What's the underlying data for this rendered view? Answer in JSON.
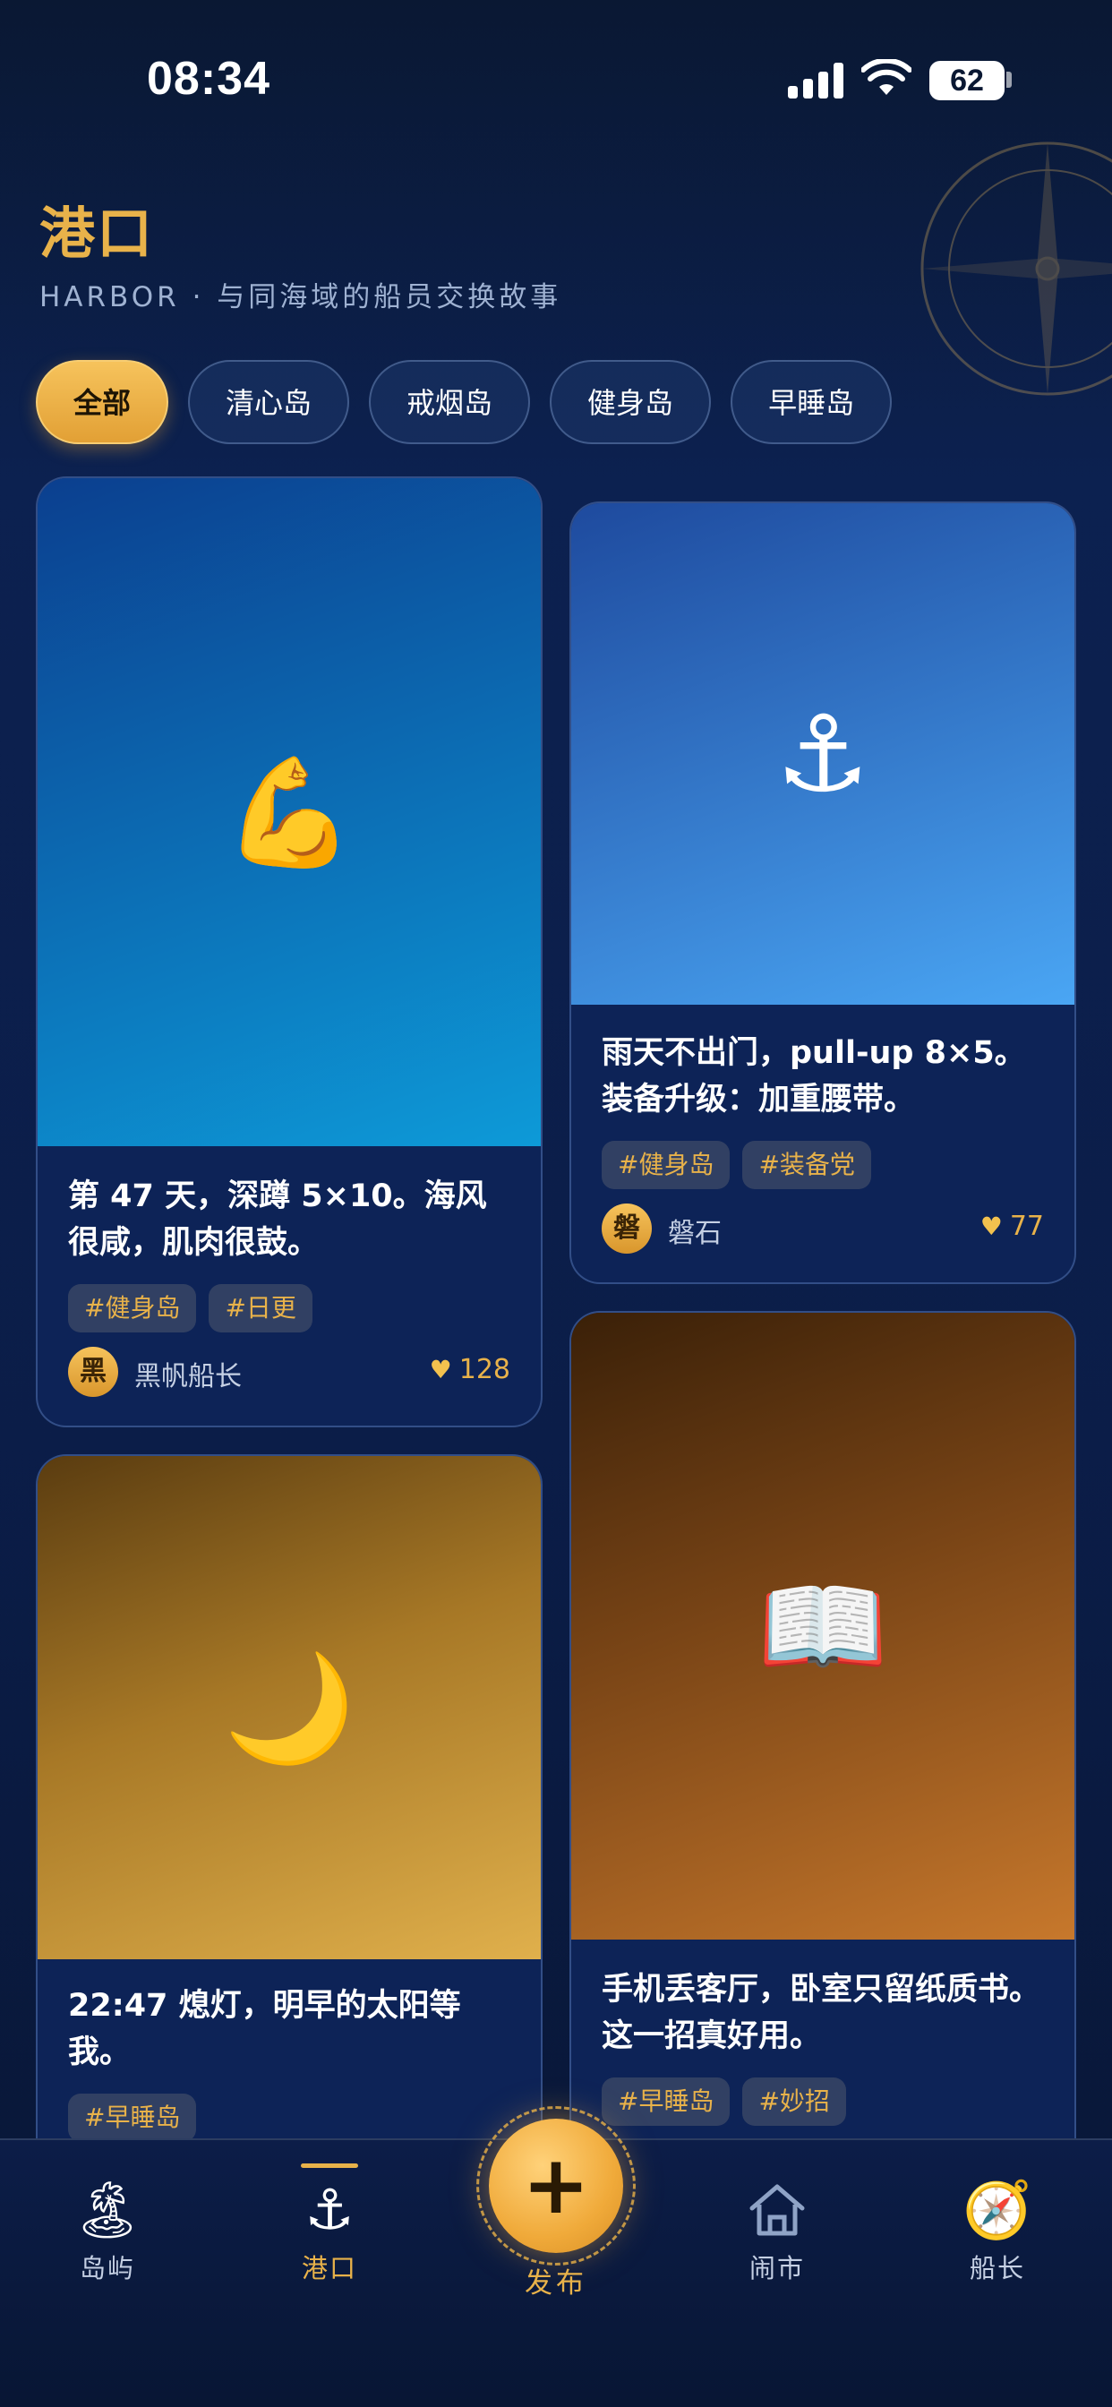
{
  "status_bar": {
    "time": "08:34",
    "battery": "62"
  },
  "header": {
    "title": "港口",
    "subtitle": "HARBOR · 与同海域的船员交换故事"
  },
  "filters": [
    {
      "label": "全部",
      "active": true
    },
    {
      "label": "清心岛",
      "active": false
    },
    {
      "label": "戒烟岛",
      "active": false
    },
    {
      "label": "健身岛",
      "active": false
    },
    {
      "label": "早睡岛",
      "active": false
    }
  ],
  "posts": [
    {
      "icon": "flexed-biceps-icon",
      "emoji": "💪",
      "text": "第 47 天，深蹲 5×10。海风很咸，肌肉很鼓。",
      "tags": [
        "#健身岛",
        "#日更"
      ],
      "avatar": "黑",
      "author": "黑帆船长",
      "likes": "128",
      "colors": [
        "#0b3f8f",
        "#0d9ad8"
      ]
    },
    {
      "icon": "anchor-icon",
      "emoji": "⚓",
      "text": "雨天不出门，pull-up 8×5。装备升级：加重腰带。",
      "tags": [
        "#健身岛",
        "#装备党"
      ],
      "avatar": "磐",
      "author": "磐石",
      "likes": "77",
      "colors": [
        "#1e4a9e",
        "#4aa6f4"
      ]
    },
    {
      "icon": "crescent-moon-icon",
      "emoji": "🌙",
      "text": "22:47 熄灯，明早的太阳等我。",
      "tags": [
        "#早睡岛"
      ],
      "colors": [
        "#5a3c10",
        "#e0b04c"
      ]
    },
    {
      "icon": "open-book-icon",
      "emoji": "📖",
      "text": "手机丢客厅，卧室只留纸质书。这一招真好用。",
      "tags": [
        "#早睡岛",
        "#妙招"
      ],
      "colors": [
        "#3a2008",
        "#c7782c"
      ]
    }
  ],
  "nav": {
    "items": [
      {
        "label": "岛屿",
        "icon": "island-icon",
        "emoji": "🏝"
      },
      {
        "label": "港口",
        "icon": "anchor-icon",
        "emoji": "⚓",
        "active": true
      },
      {
        "label": "闹市",
        "icon": "house-icon"
      },
      {
        "label": "船长",
        "icon": "compass-icon",
        "emoji": "🧭"
      }
    ],
    "publish_label": "发布",
    "publish_symbol": "+"
  }
}
